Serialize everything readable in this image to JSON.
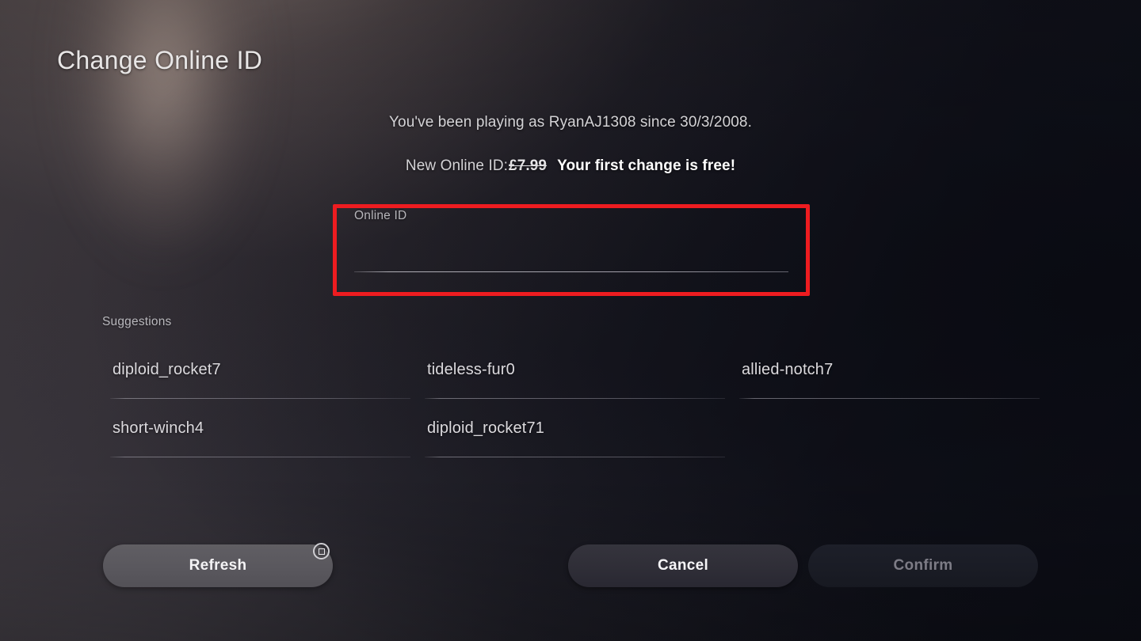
{
  "header": {
    "title": "Change Online ID"
  },
  "info": {
    "playing_since": "You've been playing as RyanAJ1308 since 30/3/2008.",
    "new_id_prefix": "New Online ID:",
    "price_struck": "£7.99",
    "free_note": "Your first change is free!"
  },
  "id_field": {
    "label": "Online ID",
    "value": "",
    "placeholder": "",
    "highlight_color": "#ee1c20"
  },
  "suggestions": {
    "heading": "Suggestions",
    "items": [
      "diploid_rocket7",
      "tideless-fur0",
      "allied-notch7",
      "short-winch4",
      "diploid_rocket71"
    ]
  },
  "buttons": {
    "refresh": "Refresh",
    "refresh_hint_icon": "playstation-square-icon",
    "cancel": "Cancel",
    "confirm": "Confirm",
    "confirm_disabled": true
  }
}
